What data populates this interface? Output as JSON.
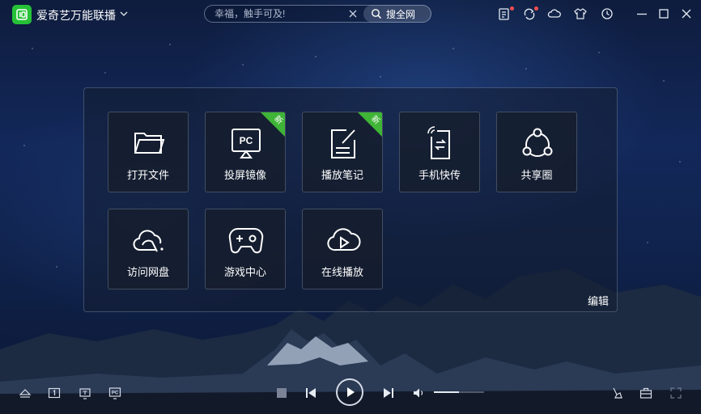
{
  "app": {
    "title": "爱奇艺万能联播",
    "brand_color": "#26c137"
  },
  "search": {
    "placeholder": "幸福，触手可及!",
    "button_label": "搜全网"
  },
  "title_icons": [
    "notes-icon",
    "sync-icon",
    "cloud-icon",
    "skin-icon",
    "history-icon",
    "minimize-icon",
    "maximize-icon",
    "close-icon"
  ],
  "panel": {
    "tiles": [
      {
        "label": "打开文件",
        "icon": "folder-icon",
        "badge": ""
      },
      {
        "label": "投屏镜像",
        "icon": "pc-cast-icon",
        "badge": "新"
      },
      {
        "label": "播放笔记",
        "icon": "note-edit-icon",
        "badge": "新"
      },
      {
        "label": "手机快传",
        "icon": "phone-transfer-icon",
        "badge": ""
      },
      {
        "label": "共享圈",
        "icon": "share-circle-icon",
        "badge": ""
      },
      {
        "label": "访问网盘",
        "icon": "cloud-drive-icon",
        "badge": ""
      },
      {
        "label": "游戏中心",
        "icon": "gamepad-icon",
        "badge": ""
      },
      {
        "label": "在线播放",
        "icon": "cloud-play-icon",
        "badge": ""
      }
    ],
    "edit_label": "编辑"
  },
  "player": {
    "volume_fraction": 0.5
  }
}
